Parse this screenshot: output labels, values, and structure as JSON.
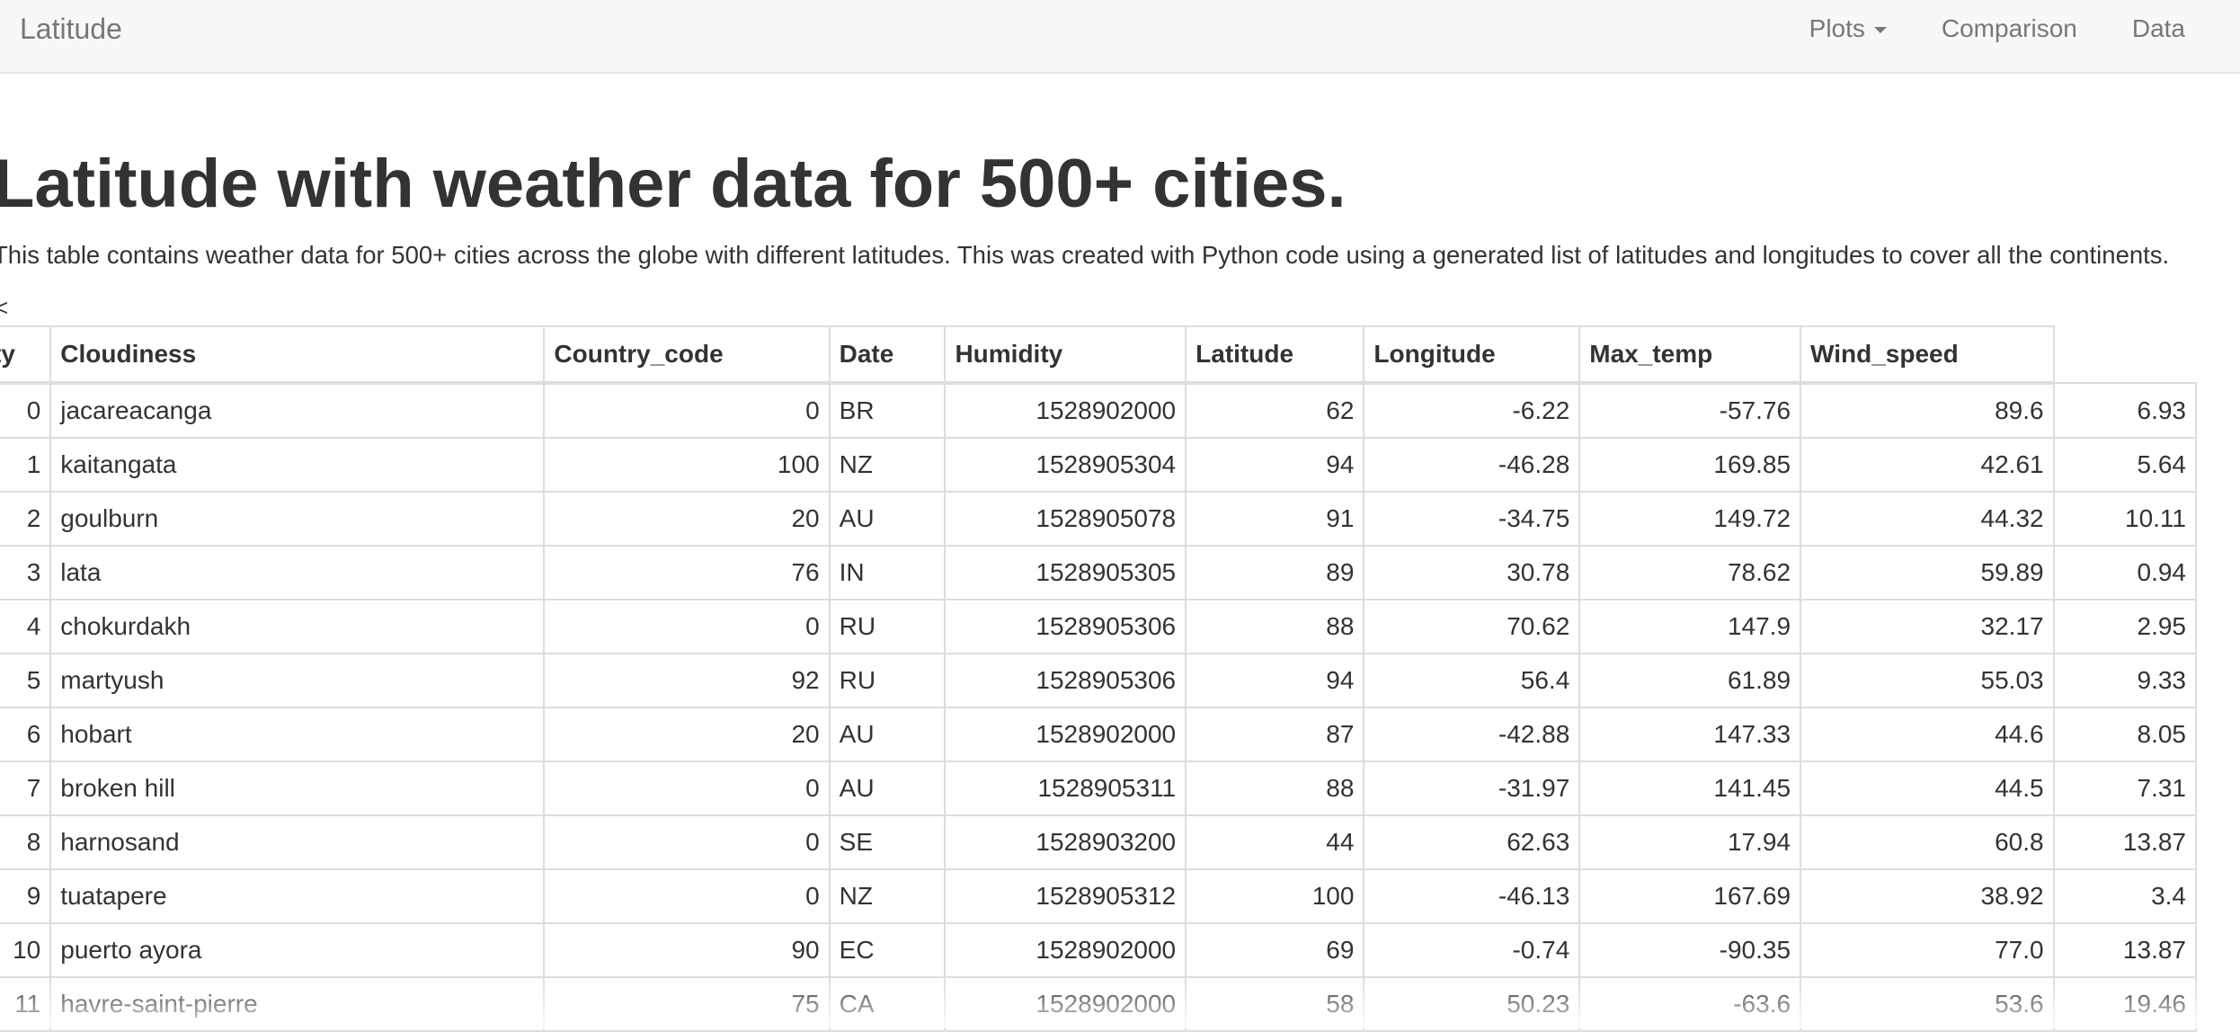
{
  "navbar": {
    "brand": "Latitude",
    "items": [
      {
        "label": "Plots",
        "has_caret": true
      },
      {
        "label": "Comparison"
      },
      {
        "label": "Data"
      }
    ]
  },
  "main": {
    "title": "Latitude with weather data for 500+ cities.",
    "description": "This table contains weather data for 500+ cities across the globe with different latitudes. This was created with Python code using a generated list of latitudes and longitudes to cover all the continents.",
    "stray_text": "<"
  },
  "table": {
    "headers": [
      "City",
      "Cloudiness",
      "Country_code",
      "Date",
      "Humidity",
      "Latitude",
      "Longitude",
      "Max_temp",
      "Wind_speed"
    ],
    "rows": [
      [
        "0",
        "jacareacanga",
        "0",
        "BR",
        "1528902000",
        "62",
        "-6.22",
        "-57.76",
        "89.6",
        "6.93"
      ],
      [
        "1",
        "kaitangata",
        "100",
        "NZ",
        "1528905304",
        "94",
        "-46.28",
        "169.85",
        "42.61",
        "5.64"
      ],
      [
        "2",
        "goulburn",
        "20",
        "AU",
        "1528905078",
        "91",
        "-34.75",
        "149.72",
        "44.32",
        "10.11"
      ],
      [
        "3",
        "lata",
        "76",
        "IN",
        "1528905305",
        "89",
        "30.78",
        "78.62",
        "59.89",
        "0.94"
      ],
      [
        "4",
        "chokurdakh",
        "0",
        "RU",
        "1528905306",
        "88",
        "70.62",
        "147.9",
        "32.17",
        "2.95"
      ],
      [
        "5",
        "martyush",
        "92",
        "RU",
        "1528905306",
        "94",
        "56.4",
        "61.89",
        "55.03",
        "9.33"
      ],
      [
        "6",
        "hobart",
        "20",
        "AU",
        "1528902000",
        "87",
        "-42.88",
        "147.33",
        "44.6",
        "8.05"
      ],
      [
        "7",
        "broken hill",
        "0",
        "AU",
        "1528905311",
        "88",
        "-31.97",
        "141.45",
        "44.5",
        "7.31"
      ],
      [
        "8",
        "harnosand",
        "0",
        "SE",
        "1528903200",
        "44",
        "62.63",
        "17.94",
        "60.8",
        "13.87"
      ],
      [
        "9",
        "tuatapere",
        "0",
        "NZ",
        "1528905312",
        "100",
        "-46.13",
        "167.69",
        "38.92",
        "3.4"
      ],
      [
        "10",
        "puerto ayora",
        "90",
        "EC",
        "1528902000",
        "69",
        "-0.74",
        "-90.35",
        "77.0",
        "13.87"
      ],
      [
        "11",
        "havre-saint-pierre",
        "75",
        "CA",
        "1528902000",
        "58",
        "50.23",
        "-63.6",
        "53.6",
        "19.46"
      ]
    ]
  }
}
